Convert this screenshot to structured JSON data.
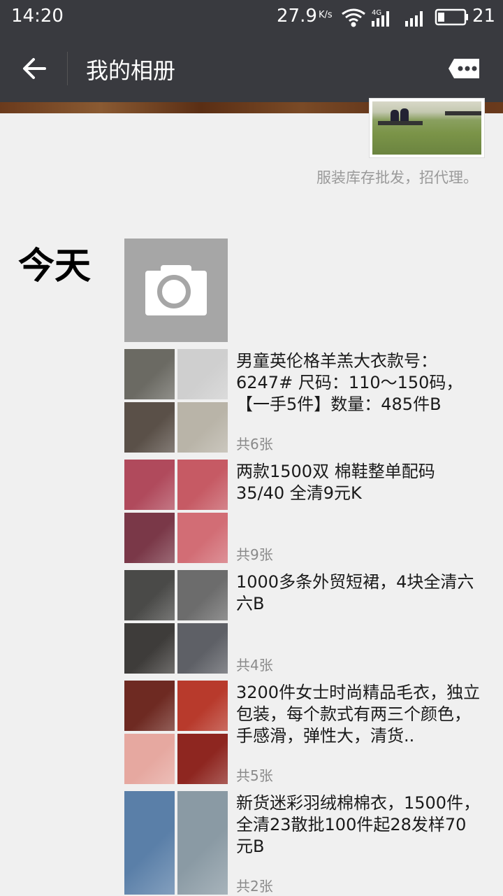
{
  "status_bar": {
    "time": "14:20",
    "net_speed": "27.9",
    "net_speed_unit": "K/s",
    "battery": "21",
    "icons": [
      "wifi-icon",
      "4g-signal-icon",
      "signal-icon",
      "battery-icon"
    ]
  },
  "header": {
    "title": "我的相册",
    "back_icon": "back-arrow-icon",
    "more_icon": "more-chat-icon"
  },
  "profile": {
    "signature": "服装库存批发，招代理。"
  },
  "day": {
    "label": "今天"
  },
  "posts": [
    {
      "text": "男童英伦格羊羔大衣款号：6247# 尺码：110～150码，【一手5件】数量：485件B",
      "count": "共6张",
      "thumb_colors": [
        "#6b6a63",
        "#cfcfcf",
        "#5a5048",
        "#b9b4a8"
      ]
    },
    {
      "text": "两款1500双 棉鞋整单配码35/40 全清9元K",
      "count": "共9张",
      "thumb_colors": [
        "#b04a5c",
        "#c65a64",
        "#7a3848",
        "#d26d75"
      ]
    },
    {
      "text": "1000多条外贸短裙，4块全清六六B",
      "count": "共4张",
      "thumb_colors": [
        "#4a4a48",
        "#6c6c6c",
        "#3e3c3a",
        "#5e6066"
      ]
    },
    {
      "text": "3200件女士时尚精品毛衣，独立包装，每个款式有两三个颜色，手感滑，弹性大，清货..",
      "count": "共5张",
      "thumb_colors": [
        "#6e2a22",
        "#b83a2c",
        "#e6a8a0",
        "#8e2620"
      ]
    },
    {
      "text": "新货迷彩羽绒棉棉衣，1500件，全清23散批100件起28发样70元B",
      "count": "共2张",
      "thumb_colors": [
        "#5a7fa8",
        "#8a9aa4"
      ]
    }
  ]
}
